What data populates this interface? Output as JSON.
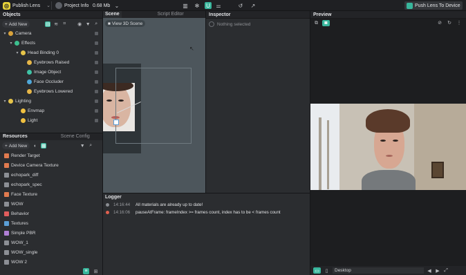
{
  "topbar": {
    "project_button": "Publish Lens",
    "project_info": "Project Info",
    "size": "0.68 Mb",
    "push_button": "Push Lens To Device"
  },
  "objects": {
    "title": "Objects",
    "add_new": "Add New",
    "items": [
      {
        "label": "Camera",
        "icon_color": "#d9a23b",
        "indent": 0,
        "caret": "▾"
      },
      {
        "label": "Effects",
        "icon_color": "#3dbf8f",
        "indent": 1,
        "caret": "▾"
      },
      {
        "label": "Head Binding 0",
        "icon_color": "#e6c44a",
        "indent": 2,
        "caret": "▾"
      },
      {
        "label": "Eyebrows Raised",
        "icon_color": "#e6b648",
        "indent": 3,
        "caret": ""
      },
      {
        "label": "Image Object",
        "icon_color": "#3fc2a5",
        "indent": 3,
        "caret": ""
      },
      {
        "label": "Face Occluder",
        "icon_color": "#4fa7d8",
        "indent": 3,
        "caret": ""
      },
      {
        "label": "Eyebrows Lowered",
        "icon_color": "#e6b648",
        "indent": 3,
        "caret": ""
      },
      {
        "label": "Lighting",
        "icon_color": "#e6c44a",
        "indent": 0,
        "caret": "▾"
      },
      {
        "label": "Envmap",
        "icon_color": "#f0c040",
        "indent": 2,
        "caret": ""
      },
      {
        "label": "Light",
        "icon_color": "#f0c040",
        "indent": 2,
        "caret": ""
      }
    ]
  },
  "resources": {
    "tab1": "Resources",
    "tab2": "Scene Config",
    "add_new": "Add New",
    "items": [
      {
        "label": "Render Target",
        "icon_color": "#e07a4f"
      },
      {
        "label": "Device Camera Texture",
        "icon_color": "#e07a4f"
      },
      {
        "label": "echopark_diff",
        "icon_color": "#8c8f95"
      },
      {
        "label": "echopark_spec",
        "icon_color": "#8c8f95"
      },
      {
        "label": "Face Texture",
        "icon_color": "#e07a4f"
      },
      {
        "label": "WOW",
        "icon_color": "#8c8f95"
      },
      {
        "label": "Behavior",
        "icon_color": "#e05d5d"
      },
      {
        "label": "Textures",
        "icon_color": "#5b9fd6"
      },
      {
        "label": "Simple PBR",
        "icon_color": "#b07fd6"
      },
      {
        "label": "WOW_1",
        "icon_color": "#8c8f95"
      },
      {
        "label": "WOW_single",
        "icon_color": "#8c8f95"
      },
      {
        "label": "WOW 2",
        "icon_color": "#8c8f95"
      }
    ]
  },
  "scene": {
    "tab1": "Scene",
    "tab2": "Script Editor",
    "view3d": "View 3D Scene"
  },
  "inspector": {
    "title": "Inspector",
    "empty": "Nothing selected"
  },
  "preview": {
    "title": "Preview",
    "device": "Desktop"
  },
  "logger": {
    "title": "Logger",
    "lines": [
      {
        "time": "14:16:44",
        "message": "All materials are already up to date!",
        "status_color": "#8a8d92"
      },
      {
        "time": "14:16:06",
        "message": "pauseAtFrame: frameIndex >= frames count, index has to be < frames count",
        "status_color": "#e0604f"
      }
    ]
  }
}
